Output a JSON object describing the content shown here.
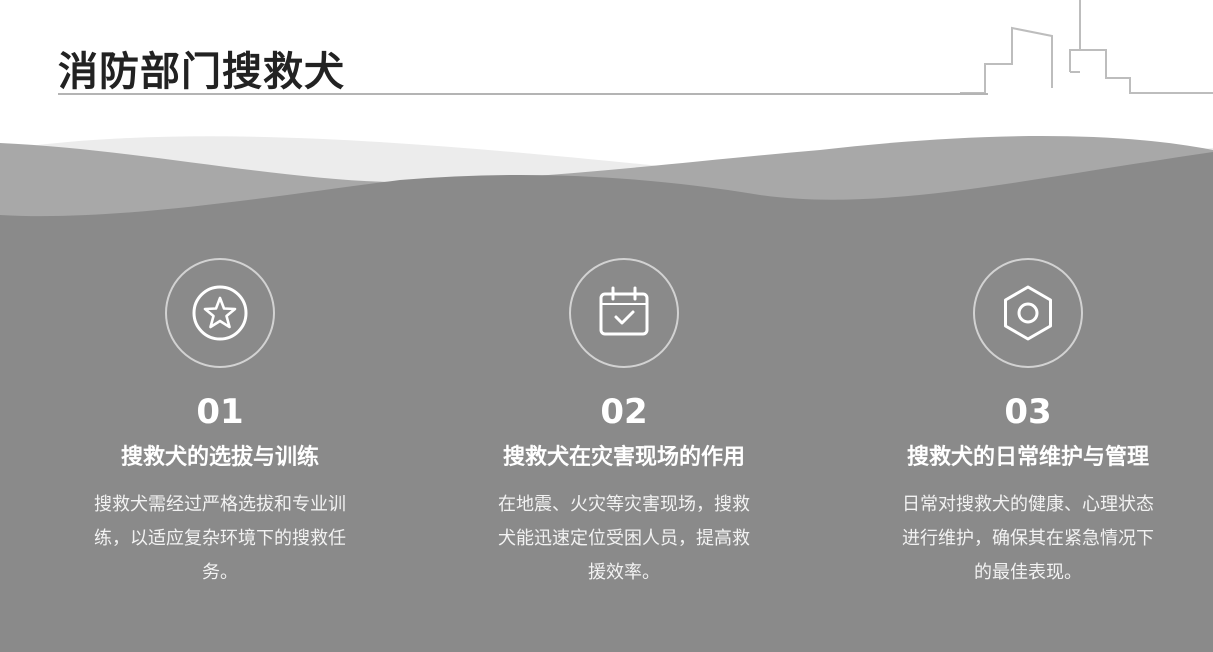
{
  "title": "消防部门搜救犬",
  "colors": {
    "background": "#ffffff",
    "panel": "#8a8a8a",
    "wave_light": "#ececec",
    "wave_mid": "#a8a8a8",
    "title_text": "#222222",
    "card_text": "#ffffff"
  },
  "cards": [
    {
      "icon": "star-icon",
      "number": "01",
      "heading": "搜救犬的选拔与训练",
      "description": "搜救犬需经过严格选拔和专业训练，以适应复杂环境下的搜救任务。"
    },
    {
      "icon": "calendar-check-icon",
      "number": "02",
      "heading": "搜救犬在灾害现场的作用",
      "description": "在地震、火灾等灾害现场，搜救犬能迅速定位受困人员，提高救援效率。"
    },
    {
      "icon": "hexagon-settings-icon",
      "number": "03",
      "heading": "搜救犬的日常维护与管理",
      "description": "日常对搜救犬的健康、心理状态进行维护，确保其在紧急情况下的最佳表现。"
    }
  ]
}
